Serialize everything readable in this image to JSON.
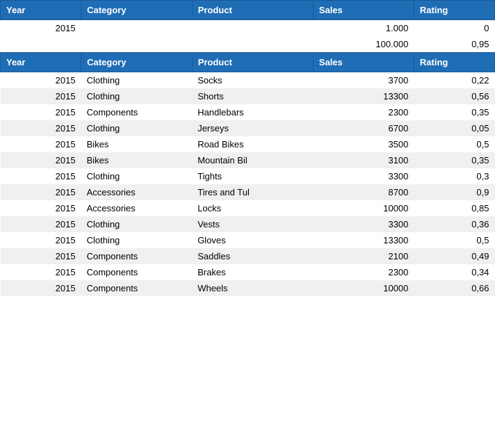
{
  "table": {
    "headers": [
      "Year",
      "Category",
      "Product",
      "Sales",
      "Rating"
    ],
    "summary": [
      {
        "year": "2015",
        "category": "",
        "product": "",
        "sales": "1.000",
        "rating": "0"
      },
      {
        "year": "",
        "category": "",
        "product": "",
        "sales": "100.000",
        "rating": "0,95"
      }
    ],
    "rows": [
      {
        "year": "2015",
        "category": "Clothing",
        "product": "Socks",
        "sales": "3700",
        "rating": "0,22"
      },
      {
        "year": "2015",
        "category": "Clothing",
        "product": "Shorts",
        "sales": "13300",
        "rating": "0,56"
      },
      {
        "year": "2015",
        "category": "Components",
        "product": "Handlebars",
        "sales": "2300",
        "rating": "0,35"
      },
      {
        "year": "2015",
        "category": "Clothing",
        "product": "Jerseys",
        "sales": "6700",
        "rating": "0,05"
      },
      {
        "year": "2015",
        "category": "Bikes",
        "product": "Road Bikes",
        "sales": "3500",
        "rating": "0,5"
      },
      {
        "year": "2015",
        "category": "Bikes",
        "product": "Mountain Bil",
        "sales": "3100",
        "rating": "0,35"
      },
      {
        "year": "2015",
        "category": "Clothing",
        "product": "Tights",
        "sales": "3300",
        "rating": "0,3"
      },
      {
        "year": "2015",
        "category": "Accessories",
        "product": "Tires and Tul",
        "sales": "8700",
        "rating": "0,9"
      },
      {
        "year": "2015",
        "category": "Accessories",
        "product": "Locks",
        "sales": "10000",
        "rating": "0,85"
      },
      {
        "year": "2015",
        "category": "Clothing",
        "product": "Vests",
        "sales": "3300",
        "rating": "0,36"
      },
      {
        "year": "2015",
        "category": "Clothing",
        "product": "Gloves",
        "sales": "13300",
        "rating": "0,5"
      },
      {
        "year": "2015",
        "category": "Components",
        "product": "Saddles",
        "sales": "2100",
        "rating": "0,49"
      },
      {
        "year": "2015",
        "category": "Components",
        "product": "Brakes",
        "sales": "2300",
        "rating": "0,34"
      },
      {
        "year": "2015",
        "category": "Components",
        "product": "Wheels",
        "sales": "10000",
        "rating": "0,66"
      }
    ]
  }
}
